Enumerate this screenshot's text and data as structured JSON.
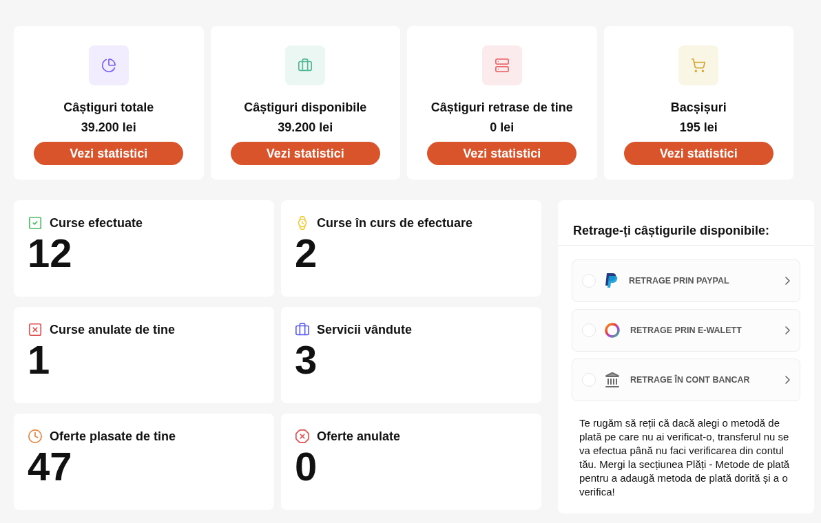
{
  "summary_cards": [
    {
      "kind": "pie",
      "title": "Câștiguri totale",
      "amount": "39.200 lei",
      "button": "Vezi statistici"
    },
    {
      "kind": "briefcase",
      "title": "Câștiguri disponibile",
      "amount": "39.200 lei",
      "button": "Vezi statistici"
    },
    {
      "kind": "server",
      "title": "Câștiguri retrase de tine",
      "amount": "0 lei",
      "button": "Vezi statistici"
    },
    {
      "kind": "cart",
      "title": "Bacșișuri",
      "amount": "195 lei",
      "button": "Vezi statistici"
    }
  ],
  "stats": [
    {
      "kind": "check",
      "label": "Curse efectuate",
      "value": "12"
    },
    {
      "kind": "watch",
      "label": "Curse în curs de efectuare",
      "value": "2"
    },
    {
      "kind": "x-square",
      "label": "Curse anulate de tine",
      "value": "1"
    },
    {
      "kind": "briefcase",
      "label": "Servicii vândute",
      "value": "3"
    },
    {
      "kind": "clock",
      "label": "Oferte plasate de tine",
      "value": "47"
    },
    {
      "kind": "x-octagon",
      "label": "Oferte anulate",
      "value": "0"
    }
  ],
  "withdraw": {
    "title": "Retrage-ți câștigurile disponibile:",
    "methods": [
      {
        "kind": "paypal",
        "label": "RETRAGE PRIN PAYPAL",
        "selected": false
      },
      {
        "kind": "ewallet",
        "label": "RETRAGE PRIN E-WALETT",
        "selected": false
      },
      {
        "kind": "bank",
        "label": "RETRAGE ÎN CONT BANCAR",
        "selected": false
      }
    ],
    "note": "Te rugăm să reții că dacă alegi o metodă de plată pe care nu ai verificat-o, transferul nu se va efectua până nu faci verificarea din contul tău. Mergi la secțiunea Plăți - Metode de plată pentru a adaugă metoda de plată dorită și a o verifica!"
  }
}
